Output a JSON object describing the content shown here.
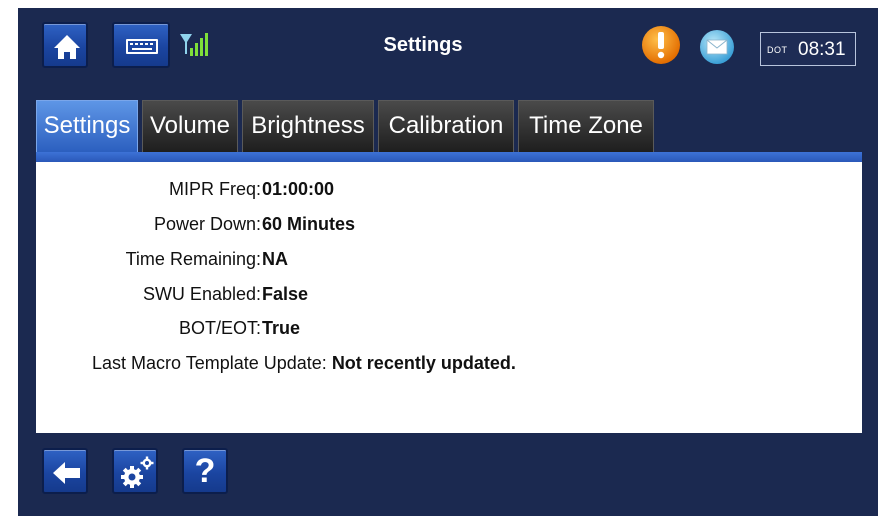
{
  "header": {
    "title": "Settings",
    "clock_timezone": "DOT",
    "clock_time": "08:31"
  },
  "tabs": [
    {
      "label": "Settings",
      "active": true
    },
    {
      "label": "Volume",
      "active": false
    },
    {
      "label": "Brightness",
      "active": false
    },
    {
      "label": "Calibration",
      "active": false
    },
    {
      "label": "Time Zone",
      "active": false
    }
  ],
  "settings": {
    "mipr_freq_label": "MIPR Freq:",
    "mipr_freq_value": "01:00:00",
    "power_down_label": "Power Down:",
    "power_down_value": "60 Minutes",
    "time_remaining_label": "Time Remaining:",
    "time_remaining_value": "NA",
    "swu_enabled_label": "SWU Enabled:",
    "swu_enabled_value": "False",
    "bot_eot_label": "BOT/EOT:",
    "bot_eot_value": "True",
    "last_macro_label": "Last Macro Template Update:",
    "last_macro_value": "Not recently updated."
  },
  "footer": {
    "help_label": "?"
  },
  "icons": [
    "home-icon",
    "keyboard-icon",
    "signal-icon",
    "alert-icon",
    "mail-icon",
    "back-arrow-icon",
    "gears-icon",
    "help-icon"
  ],
  "colors": {
    "background": "#1b2950",
    "tab_active": "#3d72d6",
    "alert": "#f08c10",
    "mail": "#5fb8e6"
  }
}
